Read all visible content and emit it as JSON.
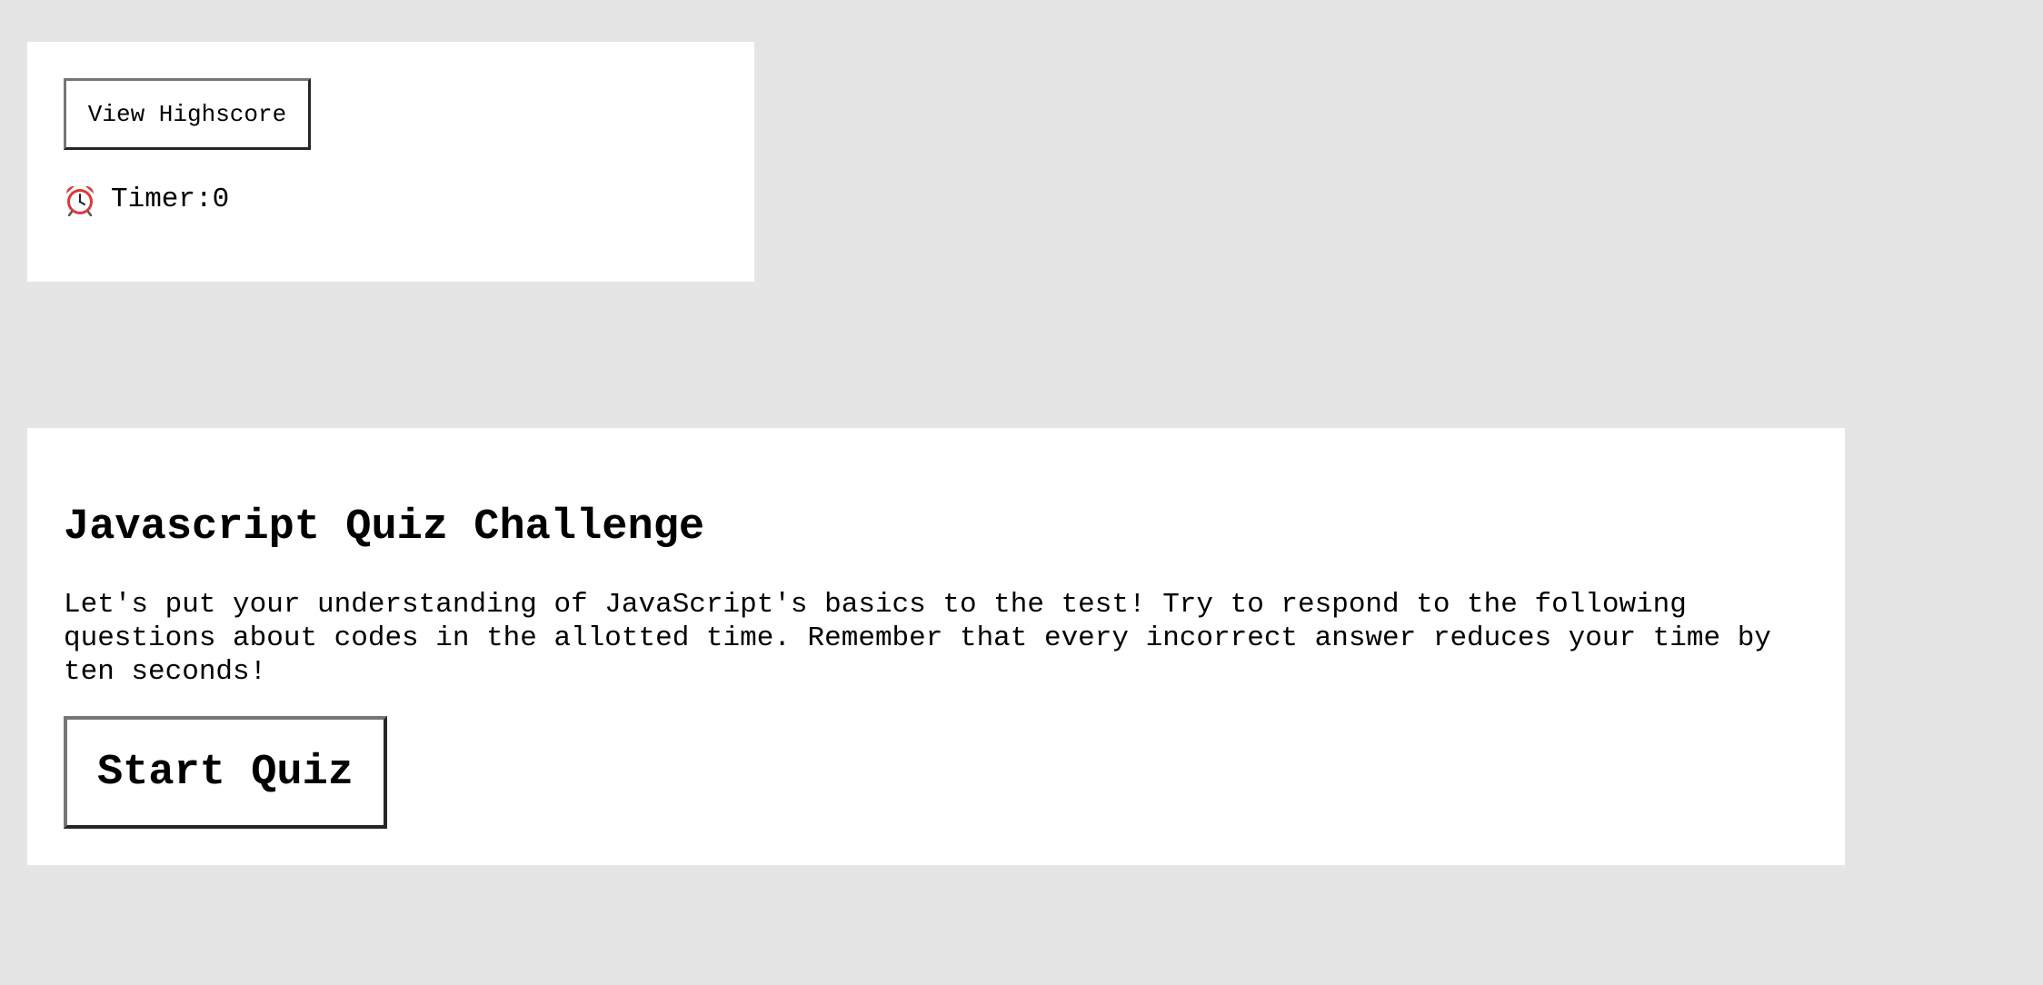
{
  "header": {
    "highscore_button_label": "View Highscore",
    "timer": {
      "icon": "alarm-clock-icon",
      "label": "Timer:",
      "value": "0"
    }
  },
  "quiz": {
    "title": "Javascript Quiz Challenge",
    "description": "Let's put your understanding of JavaScript's basics to the test! Try to respond to the following questions about codes in the allotted time. Remember that every incorrect answer reduces your time by ten seconds!",
    "start_button_label": "Start Quiz"
  },
  "colors": {
    "page_background": "#e5e5e5",
    "panel_background": "#ffffff",
    "text": "#000000",
    "clock_red": "#d93a3a"
  }
}
